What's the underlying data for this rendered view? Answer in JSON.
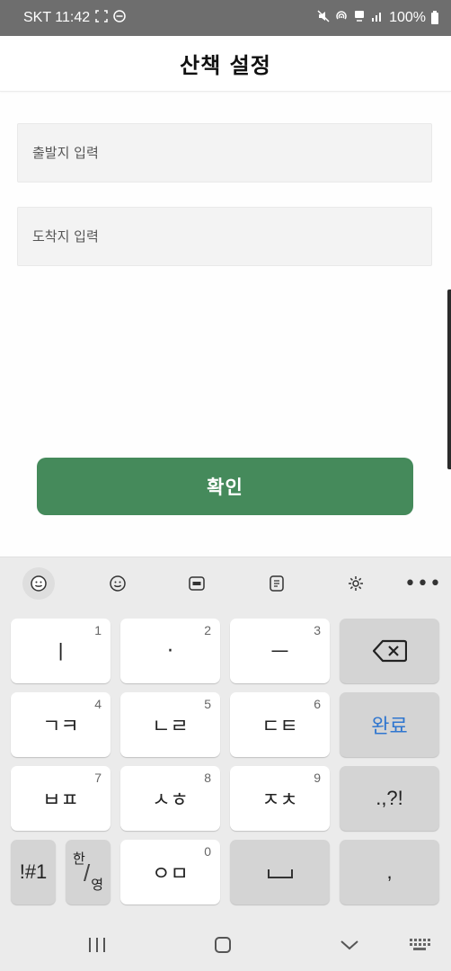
{
  "status_bar": {
    "carrier_time": "SKT 11:42",
    "battery": "100%",
    "icons": [
      "screenshot-icon",
      "dnd-icon",
      "mute-icon",
      "hotspot-icon",
      "data-icon",
      "signal-icon",
      "battery-icon"
    ]
  },
  "header": {
    "title": "산책 설정"
  },
  "form": {
    "start_placeholder": "출발지 입력",
    "end_placeholder": "도착지 입력",
    "confirm_label": "확인"
  },
  "colors": {
    "accent": "#458a5b",
    "done": "#2f76cf"
  },
  "keyboard": {
    "toolbar": [
      "emoji-sticker-icon",
      "emoji-icon",
      "gif-icon",
      "clipboard-icon",
      "settings-icon",
      "more-icon"
    ],
    "more": "•••",
    "keys": {
      "k1": {
        "label": "ㅣ",
        "num": "1"
      },
      "k2": {
        "label": "·",
        "num": "2"
      },
      "k3": {
        "label": "ㅡ",
        "num": "3"
      },
      "k4": {
        "label": "ㄱㅋ",
        "num": "4"
      },
      "k5": {
        "label": "ㄴㄹ",
        "num": "5"
      },
      "k6": {
        "label": "ㄷㅌ",
        "num": "6"
      },
      "k7": {
        "label": "ㅂㅍ",
        "num": "7"
      },
      "k8": {
        "label": "ㅅㅎ",
        "num": "8"
      },
      "k9": {
        "label": "ㅈㅊ",
        "num": "9"
      },
      "k0": {
        "label": "ㅇㅁ",
        "num": "0"
      },
      "done": "완료",
      "punct": ".,?!",
      "comma": ",",
      "sym": "!#1",
      "han": "한",
      "slash": "/",
      "eng": "영"
    }
  },
  "nav_bar": {
    "icons": [
      "recents-icon",
      "home-icon",
      "back-icon",
      "keyboard-switch-icon"
    ]
  }
}
